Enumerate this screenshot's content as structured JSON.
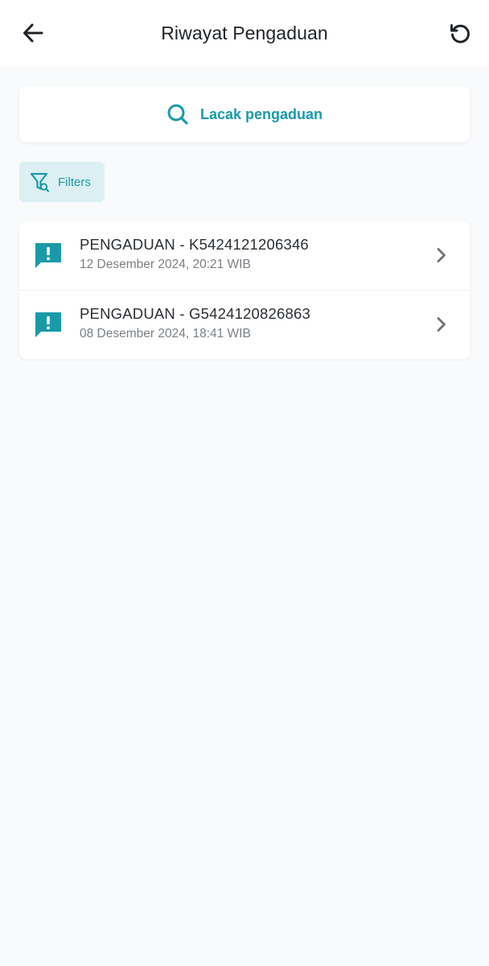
{
  "header": {
    "title": "Riwayat Pengaduan",
    "back_icon": "arrow-left-icon",
    "refresh_icon": "refresh-icon"
  },
  "search": {
    "label": "Lacak pengaduan",
    "icon": "search-icon"
  },
  "filters": {
    "label": "Filters",
    "icon": "filter-icon"
  },
  "complaints": [
    {
      "title": "PENGADUAN - K5424121206346",
      "datetime": "12 Desember 2024, 20:21 WIB",
      "icon": "feedback-alert-icon"
    },
    {
      "title": "PENGADUAN - G5424120826863",
      "datetime": "08 Desember 2024, 18:41 WIB",
      "icon": "feedback-alert-icon"
    }
  ],
  "colors": {
    "accent": "#1a9aa8",
    "filter_bg": "#dcf0f3",
    "page_bg": "#f8fafc",
    "text_primary": "#2b2f33",
    "text_secondary": "#7a7f85"
  }
}
